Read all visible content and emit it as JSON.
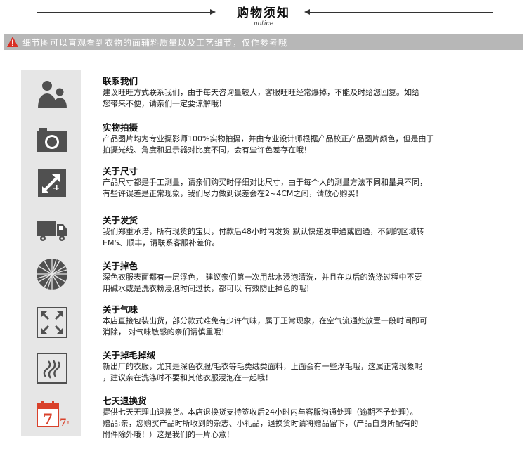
{
  "header": {
    "title": "购物须知",
    "subtitle": "notice"
  },
  "banner": {
    "text": "细节图可以直观看到衣物的面辅料质量以及工艺细节，仅作参考哦",
    "icon": "warning-icon"
  },
  "items": [
    {
      "icon": "contact-people-icon",
      "title": "联系我们",
      "lines": [
        "建议旺旺方式联系我们，由于每天咨询量较大，客服旺旺经常爆掉，不能及时给您回复。如给",
        "您带来不便，请亲们一定要谅解哦！"
      ]
    },
    {
      "icon": "camera-icon",
      "title": "实物拍摄",
      "lines": [
        "产品图片均为专业摄影师100%实物拍摄，并由专业设计师根据产品校正产品图片颜色，但是由于",
        "拍摄光线、角度和显示器对比度不同，会有些许色差存在哦！"
      ]
    },
    {
      "icon": "resize-arrow-icon",
      "title": "关于尺寸",
      "lines": [
        "产品尺寸都是手工测量，请亲们购买时仔细对比尺寸，由于每个人的测量方法不同和量具不同，",
        "有些许误差是正常现象，我们尽力做到误差会在2~4CM之间，请放心购买！"
      ]
    },
    {
      "icon": "delivery-truck-icon",
      "title": "关于发货",
      "lines": [
        "我们郑重承诺，所有现货的宝贝，付款后48小时内发货   默认快递发申通或圆通，不到的区域转",
        "EMS、顺丰，请联系客服补差价。"
      ]
    },
    {
      "icon": "color-fade-icon",
      "title": "关于掉色",
      "lines": [
        "深色衣服表面都有一层浮色，  建议亲们第一次用盐水浸泡清洗，并且在以后的洗涤过程中不要",
        "用碱水或是洗衣粉浸泡时间过长，都可以 有效防止掉色的哦！"
      ]
    },
    {
      "icon": "expand-arrows-icon",
      "title": "关于气味",
      "lines": [
        "本店直接包装出货，部分款式难免有少许气味，属于正常现象，在空气流通处放置一段时间即可",
        "消除，  对气味敏感的亲们请慎重哦！"
      ]
    },
    {
      "icon": "fabric-wave-icon",
      "title": "关于掉毛掉绒",
      "lines": [
        "新出厂的衣服，尤其是深色衣服/毛衣等毛类绒类面料，上面会有一些浮毛哦，这属正常现象呢",
        "，建议亲在洗涤时不要和其他衣服浸泡在一起哦！"
      ]
    },
    {
      "icon": "seven-day-calendar-icon",
      "title": "七天退换货",
      "lines": [
        "提供七天无理由退换货。本店退换货支持签收后24小时内与客服沟通处理（逾期不予处理）。",
        "赠品;亲，您购买产品时所收到的杂志、小礼品，退换货时请将赠品留下，（产品自身所配有的",
        "附件除外哦！）这是我们的一片心意！"
      ]
    }
  ],
  "calendar_icon": {
    "number": "7",
    "small_number": "7",
    "small_char": "天",
    "color": "#d9412b"
  },
  "colors": {
    "icon_fill": "#505050",
    "panel": "#e6e6e6",
    "banner": "#b7b7b7",
    "warning": "#d93025"
  }
}
